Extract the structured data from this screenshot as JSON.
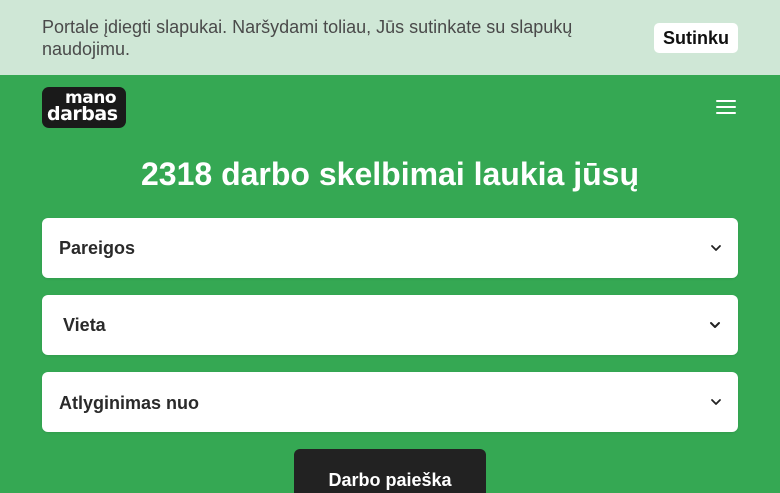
{
  "cookie_banner": {
    "text": "Portale įdiegti slapukai. Naršydami toliau, Jūs sutinkate su slapukų naudojimu.",
    "accept_label": "Sutinku"
  },
  "header": {
    "logo_top": "mano",
    "logo_bottom": "darbas",
    "menu_icon": "hamburger-menu-icon"
  },
  "hero": {
    "headline": "2318 darbo skelbimai laukia jūsų"
  },
  "filters": {
    "duties": {
      "label": "Pareigos",
      "icon": "chevron-down-icon"
    },
    "location": {
      "label": "Vieta",
      "icon": "chevron-down-icon"
    },
    "salary": {
      "label": "Atlyginimas nuo",
      "icon": "chevron-down-icon"
    }
  },
  "search": {
    "button_label": "Darbo paieška"
  },
  "colors": {
    "background": "#35a853",
    "cookie_bar": "#cfe7d6",
    "logo_bg": "#1a1a1a",
    "button_dark": "#222222"
  }
}
